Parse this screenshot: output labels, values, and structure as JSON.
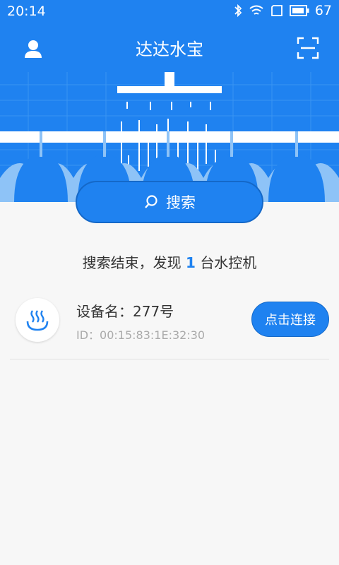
{
  "status_bar": {
    "time": "20:14",
    "battery": "67"
  },
  "app_bar": {
    "title": "达达水宝"
  },
  "search": {
    "label": "搜索"
  },
  "result": {
    "prefix": "搜索结束，发现",
    "count": "1",
    "suffix": "台水控机"
  },
  "devices": [
    {
      "name": "设备名：277号",
      "id": "ID：00:15:83:1E:32:30",
      "action": "点击连接"
    }
  ],
  "colors": {
    "primary": "#1f82f0",
    "banner_light": "#8ec3f7",
    "text": "#333333",
    "muted": "#aaaaaa"
  }
}
